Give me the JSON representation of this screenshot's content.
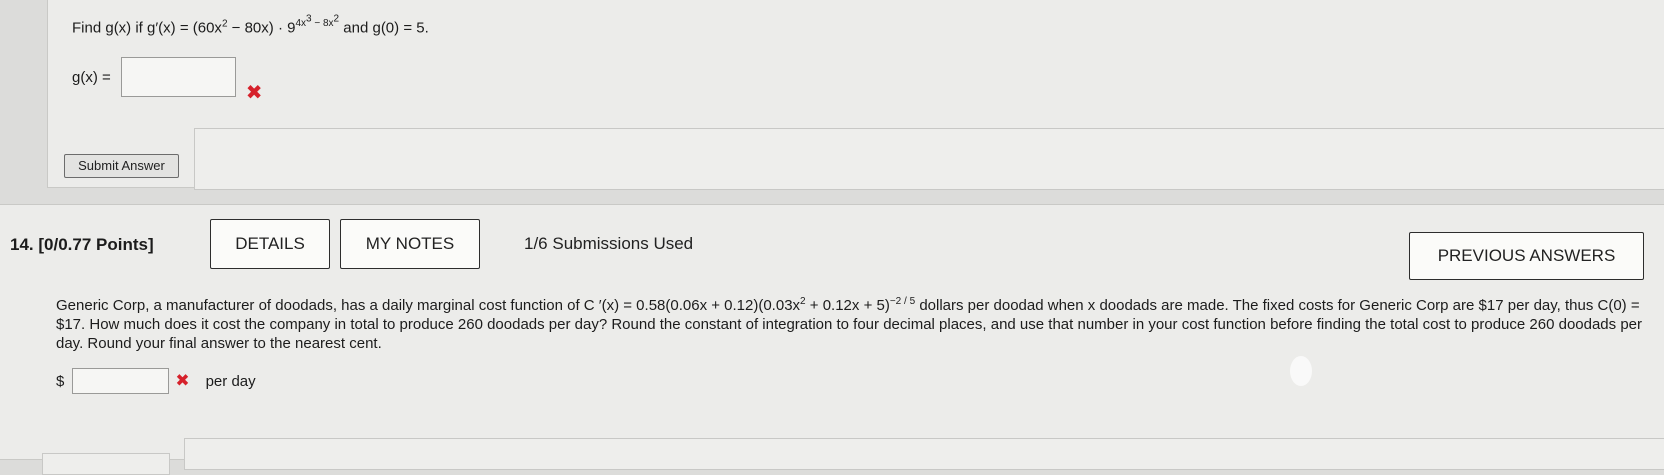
{
  "q13": {
    "find_prefix": "Find g(x) if g′(x) = (60x",
    "exp2a": "2",
    "mid": " − 80x) · 9",
    "exp_pow": "4x",
    "exp_pow_cube": "3",
    "exp_pow_minus": " − 8x",
    "exp_pow_sq": "2",
    "suffix": " and g(0) = 5.",
    "gx_label": "g(x) =",
    "submit_label": "Submit Answer"
  },
  "q14": {
    "number": "14.",
    "points": "[0/0.77 Points]",
    "details_label": "DETAILS",
    "notes_label": "MY NOTES",
    "submissions": "1/6 Submissions Used",
    "previous_label": "PREVIOUS ANSWERS",
    "problem_a": "Generic Corp, a manufacturer of doodads, has a daily marginal cost function of C ′(x) = 0.58(0.06x + 0.12)(0.03x",
    "problem_sq": "2",
    "problem_b": " + 0.12x + 5)",
    "problem_exp": "−2 / 5",
    "problem_c": " dollars per doodad when x doodads are made. The fixed costs for Generic Corp are $17 per day, thus C(0) = $17. How much does it cost the company in total to produce 260 doodads per day? Round the constant of integration to four decimal places, and use that number in your cost function before finding the total cost to produce 260 doodads per day. Round your final answer to the nearest cent.",
    "dollar": "$",
    "per_day": "per day"
  },
  "icons": {
    "incorrect": "x-mark-icon"
  },
  "colors": {
    "incorrect": "#d6212b",
    "background": "#dcdcda",
    "card": "#ececea"
  }
}
